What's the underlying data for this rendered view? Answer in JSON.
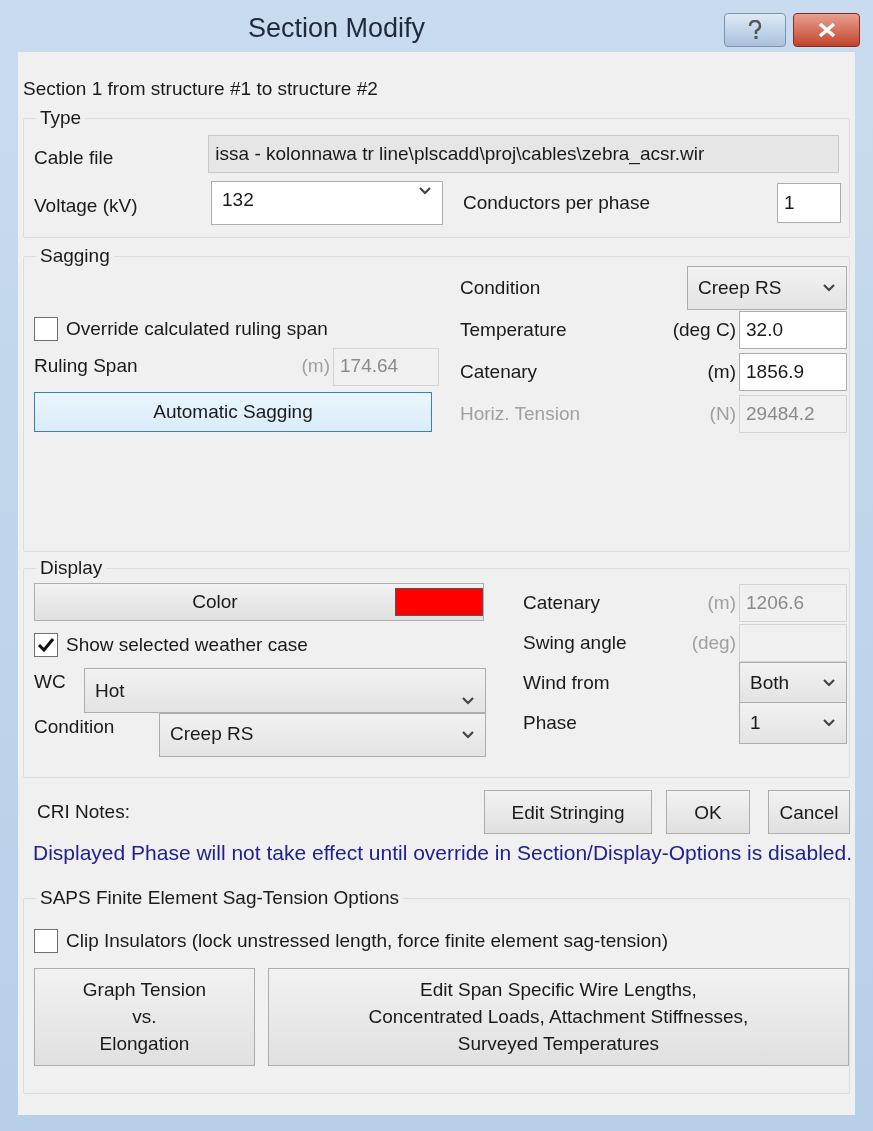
{
  "window": {
    "title": "Section Modify"
  },
  "heading": "Section 1 from structure #1 to structure #2",
  "type_group": {
    "legend": "Type",
    "cable_file": {
      "label": "Cable file",
      "value": "issa - kolonnawa tr line\\plscadd\\proj\\cables\\zebra_acsr.wir",
      "disabled": true
    },
    "voltage": {
      "label": "Voltage (kV)",
      "value": "132"
    },
    "conductors": {
      "label": "Conductors per phase",
      "value": "1"
    }
  },
  "sagging": {
    "legend": "Sagging",
    "override": {
      "label": "Override calculated ruling span",
      "checked": false
    },
    "ruling_span": {
      "label": "Ruling Span",
      "unit": "(m)",
      "value": "174.64",
      "disabled": true
    },
    "auto_button": "Automatic Sagging",
    "fields": [
      {
        "kind": "select",
        "label": "Condition",
        "value": "Creep RS"
      },
      {
        "kind": "input",
        "label": "Temperature",
        "unit": "(deg C)",
        "value": "32.0",
        "disabled": false
      },
      {
        "kind": "input",
        "label": "Catenary",
        "unit": "(m)",
        "value": "1856.9",
        "disabled": false
      },
      {
        "kind": "input",
        "label": "Horiz. Tension",
        "unit": "(N)",
        "value": "29484.2",
        "disabled": true
      }
    ]
  },
  "display": {
    "legend": "Display",
    "color_button": {
      "label": "Color",
      "color": "#ff0000"
    },
    "show_weather": {
      "label": "Show selected weather case",
      "checked": true
    },
    "wc": {
      "label": "WC",
      "value": "Hot"
    },
    "condition": {
      "label": "Condition",
      "value": "Creep RS"
    },
    "fields": [
      {
        "kind": "input",
        "label": "Catenary",
        "unit": "(m)",
        "value": "1206.6",
        "disabled": true
      },
      {
        "kind": "input",
        "label": "Swing angle",
        "unit": "(deg)",
        "disabled": true
      },
      {
        "kind": "select",
        "label": "Wind from",
        "value": "Both"
      },
      {
        "kind": "select",
        "label": "Phase",
        "value": "1"
      }
    ]
  },
  "notes_label": "CRI Notes:",
  "action_buttons": [
    "Edit Stringing",
    "OK",
    "Cancel"
  ],
  "notice": "Displayed Phase will not take effect until override in Section/Display-Options is disabled.",
  "saps": {
    "legend": "SAPS Finite Element Sag-Tension Options",
    "clip": {
      "label": "Clip Insulators (lock unstressed length, force finite element sag-tension)",
      "checked": false
    },
    "buttons": [
      "Graph Tension\nvs.\nElongation",
      "Edit Span Specific Wire Lengths,\nConcentrated Loads, Attachment Stiffnesses,\nSurveyed Temperatures"
    ]
  }
}
